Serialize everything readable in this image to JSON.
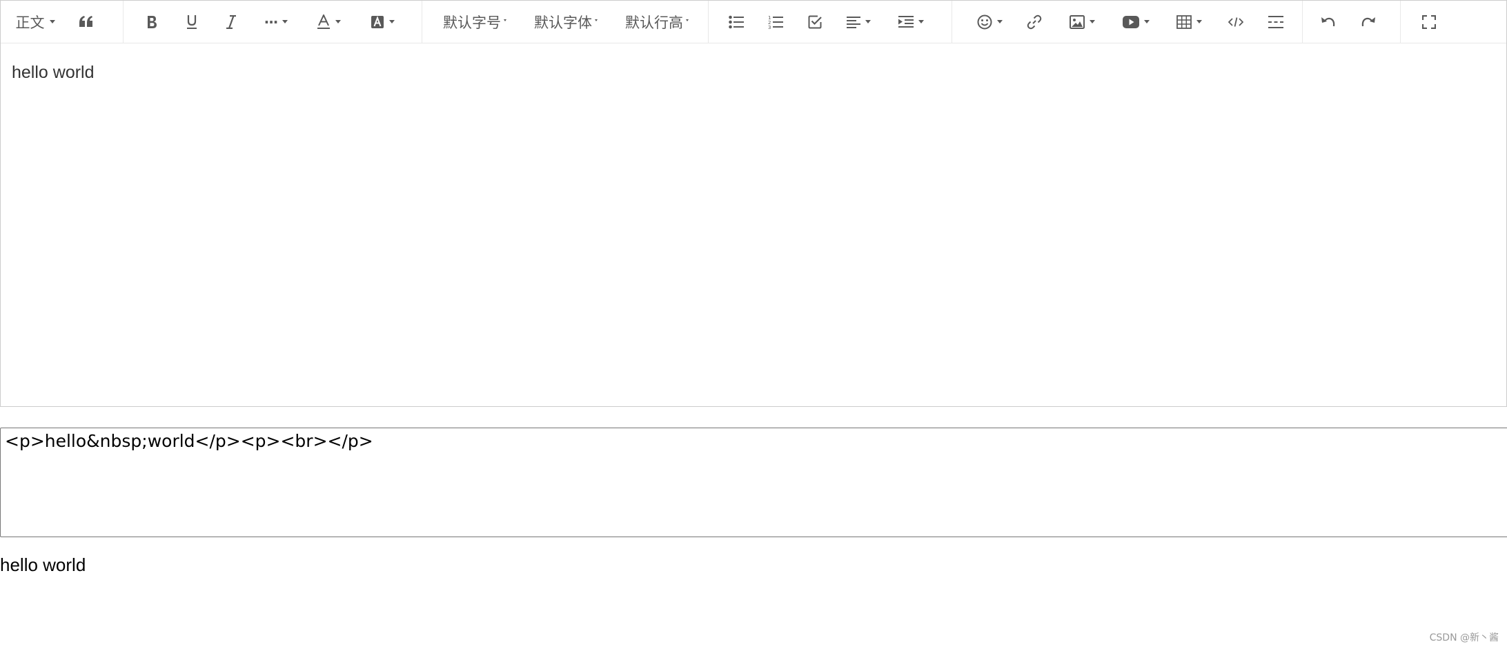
{
  "toolbar": {
    "heading_label": "正文",
    "font_size_label": "默认字号",
    "font_family_label": "默认字体",
    "line_height_label": "默认行高",
    "more_label": "···",
    "icons": [
      "blockquote-icon",
      "bold-icon",
      "underline-icon",
      "italic-icon",
      "more-style-icon",
      "font-color-icon",
      "background-color-icon",
      "bulleted-list-icon",
      "numbered-list-icon",
      "todo-icon",
      "justify-icon",
      "indent-icon",
      "emotion-icon",
      "link-icon",
      "image-icon",
      "video-icon",
      "table-icon",
      "code-block-icon",
      "divider-icon",
      "undo-icon",
      "redo-icon",
      "fullscreen-icon"
    ]
  },
  "editor": {
    "content": "hello world"
  },
  "html_output": {
    "value": "<p>hello&nbsp;world</p><p><br></p>"
  },
  "preview": {
    "text": "hello world"
  },
  "watermark": "CSDN @新丶酱",
  "colors": {
    "icon": "#595959",
    "border": "#cccccc",
    "toolbar_divider": "#e8e8e8"
  }
}
